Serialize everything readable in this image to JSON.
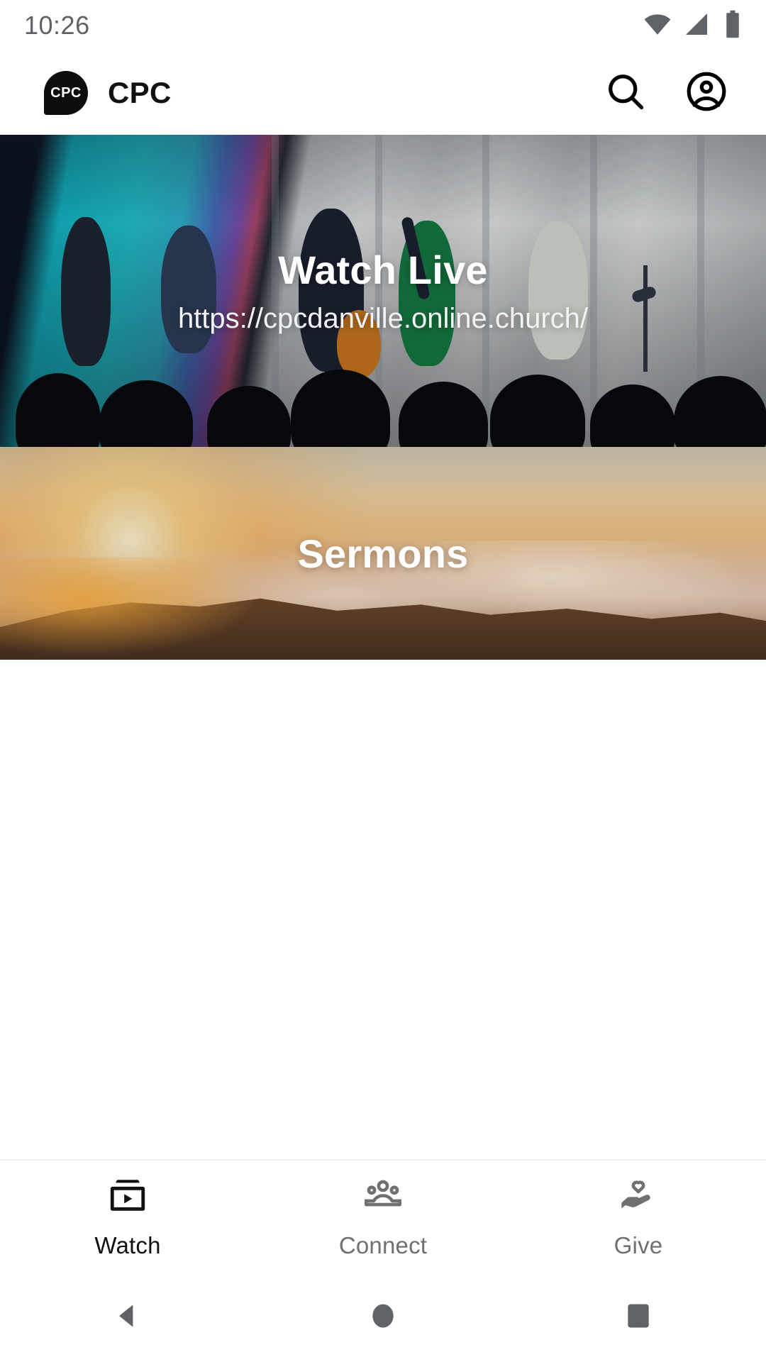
{
  "status_bar": {
    "time": "10:26",
    "icons": [
      "wifi-icon",
      "cellular-signal-icon",
      "battery-icon"
    ]
  },
  "app_bar": {
    "logo_text": "CPC",
    "title": "CPC",
    "actions": [
      {
        "name": "search-icon",
        "label": "Search"
      },
      {
        "name": "account-circle-icon",
        "label": "Account"
      }
    ]
  },
  "main": {
    "cards": [
      {
        "title": "Watch Live",
        "subtitle": "https://cpcdanville.online.church/",
        "image": "worship-band-stage"
      },
      {
        "title": "Sermons",
        "subtitle": "",
        "image": "sunrise-above-clouds"
      }
    ]
  },
  "bottom_nav": {
    "tabs": [
      {
        "label": "Watch",
        "icon": "subscriptions-icon",
        "active": true
      },
      {
        "label": "Connect",
        "icon": "people-group-icon",
        "active": false
      },
      {
        "label": "Give",
        "icon": "hand-heart-icon",
        "active": false
      }
    ]
  },
  "system_nav": {
    "buttons": [
      {
        "name": "back-button",
        "icon": "triangle-back-icon"
      },
      {
        "name": "home-button",
        "icon": "circle-home-icon"
      },
      {
        "name": "recents-button",
        "icon": "square-recents-icon"
      }
    ]
  },
  "colors": {
    "active_tab": "#121212",
    "inactive_tab": "#707070",
    "status_icon": "#5f6368",
    "brand": "#0d0d0d"
  }
}
